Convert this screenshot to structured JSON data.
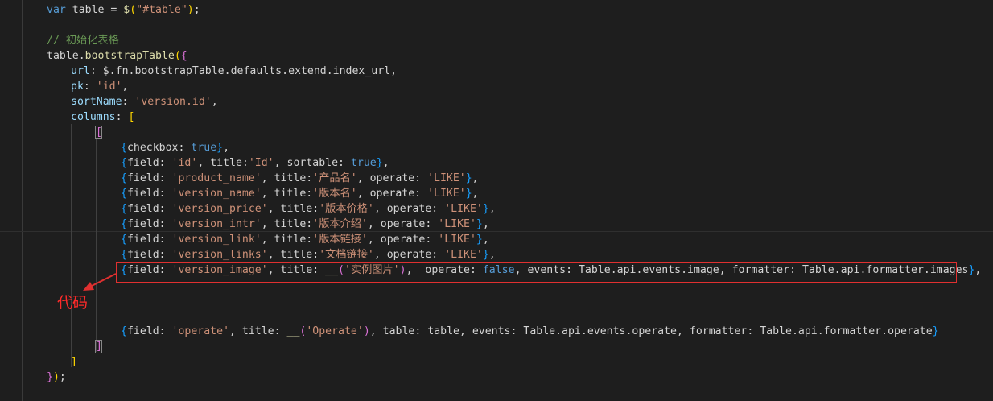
{
  "code": {
    "lines": [
      [
        {
          "t": "var",
          "c": "kw"
        },
        {
          "t": " table = ",
          "c": "pl"
        },
        {
          "t": "$",
          "c": "fn"
        },
        {
          "t": "(",
          "c": "br1"
        },
        {
          "t": "\"#table\"",
          "c": "str"
        },
        {
          "t": ")",
          "c": "br1"
        },
        {
          "t": ";",
          "c": "pl"
        }
      ],
      [
        {
          "t": "// 初始化表格",
          "c": "cm"
        }
      ],
      [
        {
          "t": "table",
          "c": "pl"
        },
        {
          "t": ".",
          "c": "pl"
        },
        {
          "t": "bootstrapTable",
          "c": "fn"
        },
        {
          "t": "(",
          "c": "br1"
        },
        {
          "t": "{",
          "c": "br2"
        }
      ],
      [
        {
          "t": "url",
          "c": "var"
        },
        {
          "t": ": ",
          "c": "pl"
        },
        {
          "t": "$",
          "c": "pl"
        },
        {
          "t": ".",
          "c": "pl"
        },
        {
          "t": "fn",
          "c": "pl"
        },
        {
          "t": ".",
          "c": "pl"
        },
        {
          "t": "bootstrapTable",
          "c": "pl"
        },
        {
          "t": ".",
          "c": "pl"
        },
        {
          "t": "defaults",
          "c": "pl"
        },
        {
          "t": ".",
          "c": "pl"
        },
        {
          "t": "extend",
          "c": "pl"
        },
        {
          "t": ".",
          "c": "pl"
        },
        {
          "t": "index_url",
          "c": "pl"
        },
        {
          "t": ",",
          "c": "pl"
        }
      ],
      [
        {
          "t": "pk",
          "c": "var"
        },
        {
          "t": ": ",
          "c": "pl"
        },
        {
          "t": "'id'",
          "c": "str"
        },
        {
          "t": ",",
          "c": "pl"
        }
      ],
      [
        {
          "t": "sortName",
          "c": "var"
        },
        {
          "t": ": ",
          "c": "pl"
        },
        {
          "t": "'version.id'",
          "c": "str"
        },
        {
          "t": ",",
          "c": "pl"
        }
      ],
      [
        {
          "t": "columns",
          "c": "var"
        },
        {
          "t": ": ",
          "c": "pl"
        },
        {
          "t": "[",
          "c": "br1"
        }
      ],
      [
        {
          "t": "[",
          "c": "br2"
        }
      ],
      [
        {
          "t": "{",
          "c": "br3"
        },
        {
          "t": "checkbox",
          "c": "pl"
        },
        {
          "t": ": ",
          "c": "pl"
        },
        {
          "t": "true",
          "c": "kw"
        },
        {
          "t": "}",
          "c": "br3"
        },
        {
          "t": ",",
          "c": "pl"
        }
      ],
      [
        {
          "t": "{",
          "c": "br3"
        },
        {
          "t": "field",
          "c": "pl"
        },
        {
          "t": ": ",
          "c": "pl"
        },
        {
          "t": "'id'",
          "c": "str"
        },
        {
          "t": ", ",
          "c": "pl"
        },
        {
          "t": "title",
          "c": "pl"
        },
        {
          "t": ":",
          "c": "pl"
        },
        {
          "t": "'Id'",
          "c": "str"
        },
        {
          "t": ", ",
          "c": "pl"
        },
        {
          "t": "sortable",
          "c": "pl"
        },
        {
          "t": ": ",
          "c": "pl"
        },
        {
          "t": "true",
          "c": "kw"
        },
        {
          "t": "}",
          "c": "br3"
        },
        {
          "t": ",",
          "c": "pl"
        }
      ],
      [
        {
          "t": "{",
          "c": "br3"
        },
        {
          "t": "field",
          "c": "pl"
        },
        {
          "t": ": ",
          "c": "pl"
        },
        {
          "t": "'product_name'",
          "c": "str"
        },
        {
          "t": ", ",
          "c": "pl"
        },
        {
          "t": "title",
          "c": "pl"
        },
        {
          "t": ":",
          "c": "pl"
        },
        {
          "t": "'产品名'",
          "c": "str"
        },
        {
          "t": ", ",
          "c": "pl"
        },
        {
          "t": "operate",
          "c": "pl"
        },
        {
          "t": ": ",
          "c": "pl"
        },
        {
          "t": "'LIKE'",
          "c": "str"
        },
        {
          "t": "}",
          "c": "br3"
        },
        {
          "t": ",",
          "c": "pl"
        }
      ],
      [
        {
          "t": "{",
          "c": "br3"
        },
        {
          "t": "field",
          "c": "pl"
        },
        {
          "t": ": ",
          "c": "pl"
        },
        {
          "t": "'version_name'",
          "c": "str"
        },
        {
          "t": ", ",
          "c": "pl"
        },
        {
          "t": "title",
          "c": "pl"
        },
        {
          "t": ":",
          "c": "pl"
        },
        {
          "t": "'版本名'",
          "c": "str"
        },
        {
          "t": ", ",
          "c": "pl"
        },
        {
          "t": "operate",
          "c": "pl"
        },
        {
          "t": ": ",
          "c": "pl"
        },
        {
          "t": "'LIKE'",
          "c": "str"
        },
        {
          "t": "}",
          "c": "br3"
        },
        {
          "t": ",",
          "c": "pl"
        }
      ],
      [
        {
          "t": "{",
          "c": "br3"
        },
        {
          "t": "field",
          "c": "pl"
        },
        {
          "t": ": ",
          "c": "pl"
        },
        {
          "t": "'version_price'",
          "c": "str"
        },
        {
          "t": ", ",
          "c": "pl"
        },
        {
          "t": "title",
          "c": "pl"
        },
        {
          "t": ":",
          "c": "pl"
        },
        {
          "t": "'版本价格'",
          "c": "str"
        },
        {
          "t": ", ",
          "c": "pl"
        },
        {
          "t": "operate",
          "c": "pl"
        },
        {
          "t": ": ",
          "c": "pl"
        },
        {
          "t": "'LIKE'",
          "c": "str"
        },
        {
          "t": "}",
          "c": "br3"
        },
        {
          "t": ",",
          "c": "pl"
        }
      ],
      [
        {
          "t": "{",
          "c": "br3"
        },
        {
          "t": "field",
          "c": "pl"
        },
        {
          "t": ": ",
          "c": "pl"
        },
        {
          "t": "'version_intr'",
          "c": "str"
        },
        {
          "t": ", ",
          "c": "pl"
        },
        {
          "t": "title",
          "c": "pl"
        },
        {
          "t": ":",
          "c": "pl"
        },
        {
          "t": "'版本介绍'",
          "c": "str"
        },
        {
          "t": ", ",
          "c": "pl"
        },
        {
          "t": "operate",
          "c": "pl"
        },
        {
          "t": ": ",
          "c": "pl"
        },
        {
          "t": "'LIKE'",
          "c": "str"
        },
        {
          "t": "}",
          "c": "br3"
        },
        {
          "t": ",",
          "c": "pl"
        }
      ],
      [
        {
          "t": "{",
          "c": "br3"
        },
        {
          "t": "field",
          "c": "pl"
        },
        {
          "t": ": ",
          "c": "pl"
        },
        {
          "t": "'version_link'",
          "c": "str"
        },
        {
          "t": ", ",
          "c": "pl"
        },
        {
          "t": "title",
          "c": "pl"
        },
        {
          "t": ":",
          "c": "pl"
        },
        {
          "t": "'版本链接'",
          "c": "str"
        },
        {
          "t": ", ",
          "c": "pl"
        },
        {
          "t": "operate",
          "c": "pl"
        },
        {
          "t": ": ",
          "c": "pl"
        },
        {
          "t": "'LIKE'",
          "c": "str"
        },
        {
          "t": "}",
          "c": "br3"
        },
        {
          "t": ",",
          "c": "pl"
        }
      ],
      [
        {
          "t": "{",
          "c": "br3"
        },
        {
          "t": "field",
          "c": "pl"
        },
        {
          "t": ": ",
          "c": "pl"
        },
        {
          "t": "'version_links'",
          "c": "str"
        },
        {
          "t": ", ",
          "c": "pl"
        },
        {
          "t": "title",
          "c": "pl"
        },
        {
          "t": ":",
          "c": "pl"
        },
        {
          "t": "'文档链接'",
          "c": "str"
        },
        {
          "t": ", ",
          "c": "pl"
        },
        {
          "t": "operate",
          "c": "pl"
        },
        {
          "t": ": ",
          "c": "pl"
        },
        {
          "t": "'LIKE'",
          "c": "str"
        },
        {
          "t": "}",
          "c": "br3"
        },
        {
          "t": ",",
          "c": "pl"
        }
      ],
      [
        {
          "t": "{",
          "c": "br3"
        },
        {
          "t": "field",
          "c": "pl"
        },
        {
          "t": ": ",
          "c": "pl"
        },
        {
          "t": "'version_image'",
          "c": "str"
        },
        {
          "t": ", ",
          "c": "pl"
        },
        {
          "t": "title",
          "c": "pl"
        },
        {
          "t": ": ",
          "c": "pl"
        },
        {
          "t": "__",
          "c": "fn"
        },
        {
          "t": "(",
          "c": "br2"
        },
        {
          "t": "'实例图片'",
          "c": "str"
        },
        {
          "t": ")",
          "c": "br2"
        },
        {
          "t": ",  ",
          "c": "pl"
        },
        {
          "t": "operate",
          "c": "pl"
        },
        {
          "t": ": ",
          "c": "pl"
        },
        {
          "t": "false",
          "c": "kw"
        },
        {
          "t": ", ",
          "c": "pl"
        },
        {
          "t": "events",
          "c": "pl"
        },
        {
          "t": ": ",
          "c": "pl"
        },
        {
          "t": "Table",
          "c": "pl"
        },
        {
          "t": ".",
          "c": "pl"
        },
        {
          "t": "api",
          "c": "pl"
        },
        {
          "t": ".",
          "c": "pl"
        },
        {
          "t": "events",
          "c": "pl"
        },
        {
          "t": ".",
          "c": "pl"
        },
        {
          "t": "image",
          "c": "pl"
        },
        {
          "t": ", ",
          "c": "pl"
        },
        {
          "t": "formatter",
          "c": "pl"
        },
        {
          "t": ": ",
          "c": "pl"
        },
        {
          "t": "Table",
          "c": "pl"
        },
        {
          "t": ".",
          "c": "pl"
        },
        {
          "t": "api",
          "c": "pl"
        },
        {
          "t": ".",
          "c": "pl"
        },
        {
          "t": "formatter",
          "c": "pl"
        },
        {
          "t": ".",
          "c": "pl"
        },
        {
          "t": "images",
          "c": "pl"
        },
        {
          "t": "}",
          "c": "br3"
        },
        {
          "t": ",",
          "c": "pl"
        }
      ],
      [
        {
          "t": "{",
          "c": "br3"
        },
        {
          "t": "field",
          "c": "pl"
        },
        {
          "t": ": ",
          "c": "pl"
        },
        {
          "t": "'operate'",
          "c": "str"
        },
        {
          "t": ", ",
          "c": "pl"
        },
        {
          "t": "title",
          "c": "pl"
        },
        {
          "t": ": ",
          "c": "pl"
        },
        {
          "t": "__",
          "c": "fn"
        },
        {
          "t": "(",
          "c": "br2"
        },
        {
          "t": "'Operate'",
          "c": "str"
        },
        {
          "t": ")",
          "c": "br2"
        },
        {
          "t": ", ",
          "c": "pl"
        },
        {
          "t": "table",
          "c": "pl"
        },
        {
          "t": ": ",
          "c": "pl"
        },
        {
          "t": "table",
          "c": "pl"
        },
        {
          "t": ", ",
          "c": "pl"
        },
        {
          "t": "events",
          "c": "pl"
        },
        {
          "t": ": ",
          "c": "pl"
        },
        {
          "t": "Table",
          "c": "pl"
        },
        {
          "t": ".",
          "c": "pl"
        },
        {
          "t": "api",
          "c": "pl"
        },
        {
          "t": ".",
          "c": "pl"
        },
        {
          "t": "events",
          "c": "pl"
        },
        {
          "t": ".",
          "c": "pl"
        },
        {
          "t": "operate",
          "c": "pl"
        },
        {
          "t": ", ",
          "c": "pl"
        },
        {
          "t": "formatter",
          "c": "pl"
        },
        {
          "t": ": ",
          "c": "pl"
        },
        {
          "t": "Table",
          "c": "pl"
        },
        {
          "t": ".",
          "c": "pl"
        },
        {
          "t": "api",
          "c": "pl"
        },
        {
          "t": ".",
          "c": "pl"
        },
        {
          "t": "formatter",
          "c": "pl"
        },
        {
          "t": ".",
          "c": "pl"
        },
        {
          "t": "operate",
          "c": "pl"
        },
        {
          "t": "}",
          "c": "br3"
        }
      ],
      [
        {
          "t": "]",
          "c": "br2"
        }
      ],
      [
        {
          "t": "]",
          "c": "br1"
        }
      ],
      [
        {
          "t": "}",
          "c": "br2"
        },
        {
          "t": ")",
          "c": "br1"
        },
        {
          "t": ";",
          "c": "pl"
        }
      ]
    ]
  },
  "annotation": {
    "label": "代码",
    "box_color": "#e03030",
    "text_color": "#ff2a2a"
  },
  "theme": {
    "background": "#1e1e1e",
    "keyword": "#569cd6",
    "string": "#ce9178",
    "comment": "#6a9955",
    "function": "#dcdcaa",
    "variable": "#9cdcfe"
  }
}
